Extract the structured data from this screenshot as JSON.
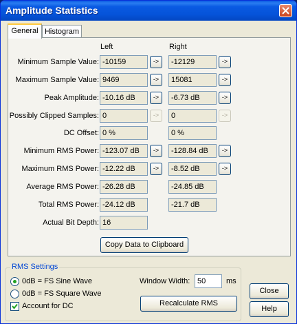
{
  "window": {
    "title": "Amplitude Statistics"
  },
  "tabs": [
    {
      "label": "General"
    },
    {
      "label": "Histogram"
    }
  ],
  "columns": {
    "left": "Left",
    "right": "Right"
  },
  "rows": [
    {
      "label": "Minimum Sample Value:",
      "left": "-10159",
      "right": "-12129"
    },
    {
      "label": "Maximum Sample Value:",
      "left": "9469",
      "right": "15081"
    },
    {
      "label": "Peak Amplitude:",
      "left": "-10.16 dB",
      "right": "-6.73 dB"
    },
    {
      "label": "Possibly Clipped Samples:",
      "left": "0",
      "right": "0"
    },
    {
      "label": "DC Offset:",
      "left": "0 %",
      "right": "0 %"
    },
    {
      "label": "Minimum RMS Power:",
      "left": "-123.07 dB",
      "right": "-128.84 dB"
    },
    {
      "label": "Maximum RMS Power:",
      "left": "-12.22 dB",
      "right": "-8.52 dB"
    },
    {
      "label": "Average RMS Power:",
      "left": "-26.28 dB",
      "right": "-24.85 dB"
    },
    {
      "label": "Total RMS Power:",
      "left": "-24.12 dB",
      "right": "-21.7 dB"
    },
    {
      "label": "Actual Bit Depth:",
      "left": "16"
    }
  ],
  "arrow_label": "->",
  "copy_button": "Copy Data to Clipboard",
  "rms_settings": {
    "title": "RMS Settings",
    "sine_label": "0dB = FS Sine Wave",
    "square_label": "0dB = FS Square Wave",
    "dc_label": "Account for DC",
    "window_width_label": "Window Width:",
    "window_width_value": "50",
    "window_width_unit": "ms",
    "recalc_button": "Recalculate RMS"
  },
  "buttons": {
    "close": "Close",
    "help": "Help"
  },
  "icons": {
    "close": "close-x-icon",
    "arrow": "arrow-right-icon"
  }
}
